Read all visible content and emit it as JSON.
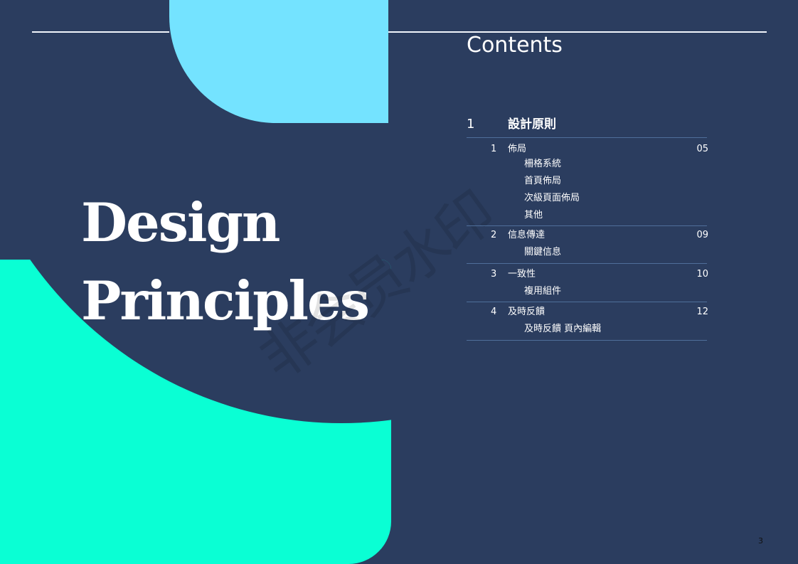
{
  "page": {
    "title_line1": "Design",
    "title_line2": "Principles",
    "watermark": "非会员水印",
    "page_number": "3"
  },
  "toc": {
    "heading": "Contents",
    "section": {
      "number": "1",
      "title": "設計原則"
    },
    "items": [
      {
        "number": "1",
        "label": "佈局",
        "page": "05",
        "subitems": [
          "柵格系統",
          "首頁佈局",
          "次級頁面佈局",
          "其他"
        ]
      },
      {
        "number": "2",
        "label": "信息傳達",
        "page": "09",
        "subitems": [
          "關鍵信息"
        ]
      },
      {
        "number": "3",
        "label": "一致性",
        "page": "10",
        "subitems": [
          "複用組件"
        ]
      },
      {
        "number": "4",
        "label": "及時反饋",
        "page": "12",
        "subitems": [
          "及時反饋 頁內編輯"
        ]
      }
    ]
  },
  "colors": {
    "background": "#2b3d5f",
    "accent_cyan": "#74e3ff",
    "accent_teal": "#0affd4",
    "text": "#ffffff"
  }
}
